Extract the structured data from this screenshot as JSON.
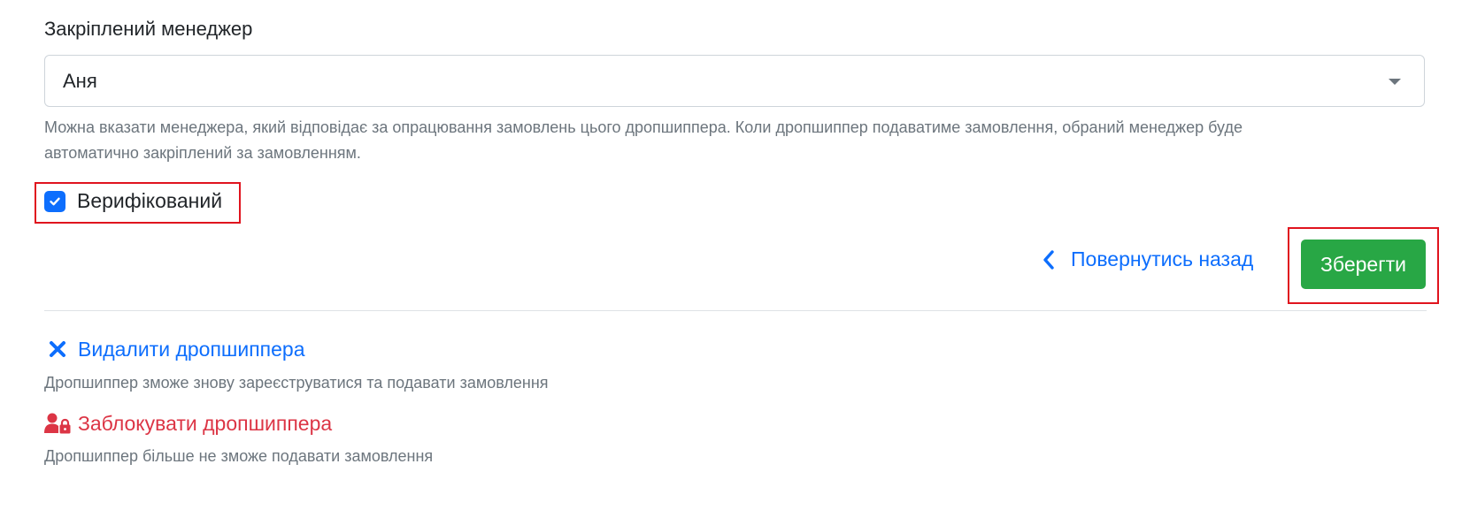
{
  "manager": {
    "label": "Закріплений менеджер",
    "selected": "Аня",
    "help_line1": "Можна вказати менеджера, який відповідає за опрацювання замовлень цього дропшиппера. Коли дропшиппер подаватиме замовлення, обраний менеджер буде",
    "help_line2": "автоматично закріплений за замовленням."
  },
  "verified": {
    "label": "Верифікований",
    "checked": true
  },
  "actions": {
    "back_label": "Повернутись назад",
    "save_label": "Зберегти"
  },
  "danger": {
    "delete_label": "Видалити дропшиппера",
    "delete_help": "Дропшиппер зможе знову зареєструватися та подавати замовлення",
    "block_label": "Заблокувати дропшиппера",
    "block_help": "Дропшиппер більше не зможе подавати замовлення"
  },
  "colors": {
    "primary": "#0d6efd",
    "success": "#28a745",
    "danger": "#dc3545",
    "muted": "#6c757d",
    "highlight": "#e0141e"
  },
  "icons": {
    "check": "check-icon",
    "back": "chevron-left-icon",
    "delete": "close-icon",
    "block": "user-lock-icon",
    "select": "caret-down-icon"
  }
}
